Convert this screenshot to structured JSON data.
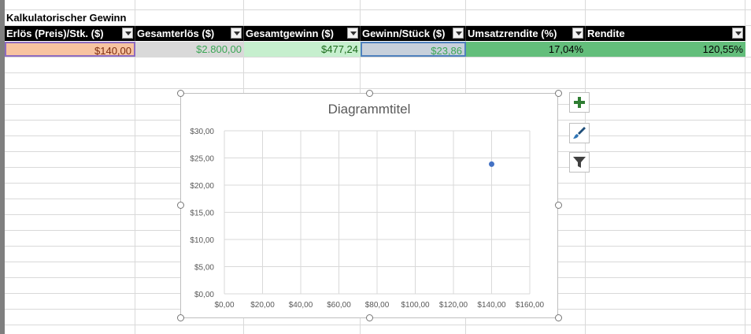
{
  "sheet": {
    "title": "Kalkulatorischer Gewinn",
    "headers": [
      "Erlös (Preis)/Stk. ($)",
      "Gesamterlös ($)",
      "Gesamtgewinn ($)",
      "Gewinn/Stück ($)",
      "Umsatzrendite (%)",
      "Rendite"
    ],
    "values": [
      "$140,00",
      "$2.800,00",
      "$477,24",
      "$23,86",
      "17,04%",
      "120,55%"
    ],
    "value_colors": {
      "fills": [
        "#f7c3a0",
        "#d9d9d9",
        "#c6efce",
        "#c7d0db",
        "#63be7b",
        "#63be7b"
      ],
      "text": [
        "#7f2d0f",
        "#3aa655",
        "#1b6b1b",
        "#3aa655",
        "#000000",
        "#000000"
      ]
    },
    "header_bg": "#000000",
    "header_fg": "#ffffff"
  },
  "chart": {
    "title": "Diagrammtitel",
    "buttons": [
      "plus-icon",
      "brush-icon",
      "filter-icon"
    ]
  },
  "chart_data": {
    "type": "scatter",
    "title": "Diagrammtitel",
    "xlim": [
      0,
      160
    ],
    "ylim": [
      0,
      30
    ],
    "x_ticks": [
      "$0,00",
      "$20,00",
      "$40,00",
      "$60,00",
      "$80,00",
      "$100,00",
      "$120,00",
      "$140,00",
      "$160,00"
    ],
    "y_ticks": [
      "$0,00",
      "$5,00",
      "$10,00",
      "$15,00",
      "$20,00",
      "$25,00",
      "$30,00"
    ],
    "x_tick_values": [
      0,
      20,
      40,
      60,
      80,
      100,
      120,
      140,
      160
    ],
    "y_tick_values": [
      0,
      5,
      10,
      15,
      20,
      25,
      30
    ],
    "points": [
      {
        "x": 140,
        "y": 23.86
      }
    ],
    "grid": true,
    "marker_color": "#4472c4"
  }
}
